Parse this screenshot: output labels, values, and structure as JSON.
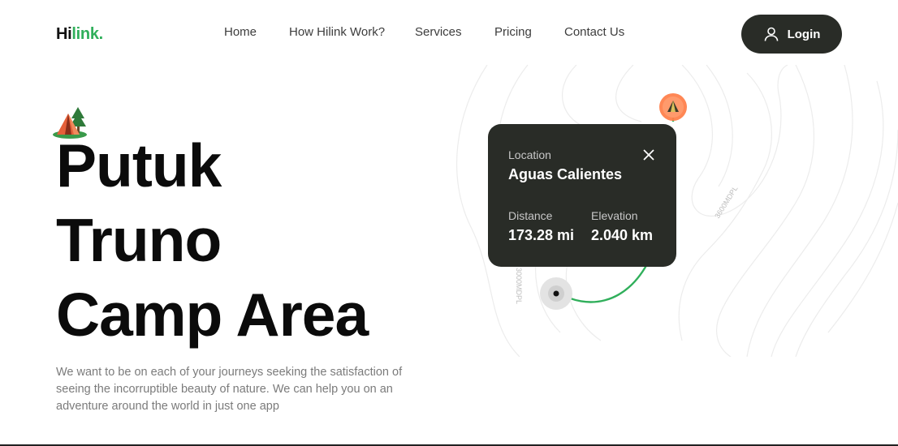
{
  "header": {
    "logo_dark": "Hi",
    "logo_green": "link.",
    "nav": [
      "Home",
      "How Hilink Work?",
      "Services",
      "Pricing",
      "Contact Us"
    ],
    "login_label": "Login"
  },
  "hero": {
    "title_lines": [
      "Putuk",
      "Truno",
      "Camp Area"
    ],
    "description": "We want to be on each of your journeys seeking the satisfaction of seeing the incorruptible beauty of nature. We can help you on an adventure around the world in just one app"
  },
  "map": {
    "contour_labels": [
      "3600MDPL",
      "3000MDPL"
    ]
  },
  "card": {
    "location_label": "Location",
    "location_value": "Aguas Calientes",
    "distance_label": "Distance",
    "distance_value": "173.28 mi",
    "elevation_label": "Elevation",
    "elevation_value": "2.040 km"
  },
  "colors": {
    "brand_green": "#30AF5B",
    "dark": "#292C27",
    "pin_orange": "#FF814C"
  }
}
